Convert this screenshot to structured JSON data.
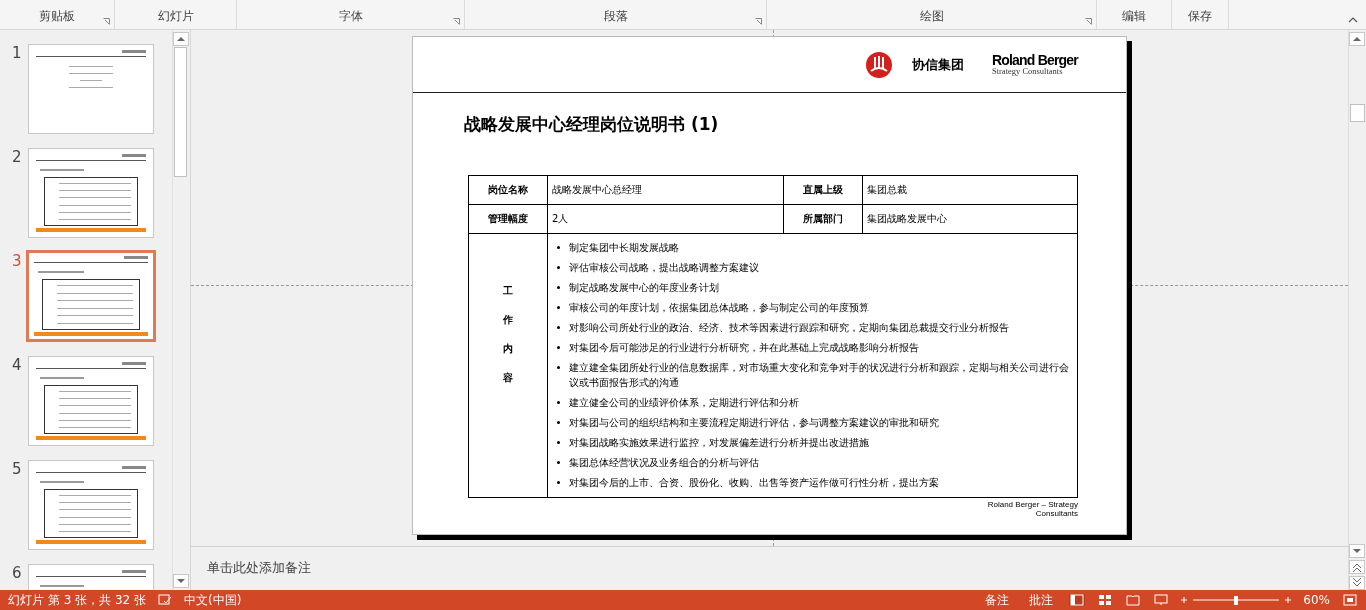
{
  "ribbon": {
    "groups": [
      {
        "label": "剪贴板",
        "launcher": true
      },
      {
        "label": "幻灯片",
        "launcher": false
      },
      {
        "label": "字体",
        "launcher": true
      },
      {
        "label": "段落",
        "launcher": true
      },
      {
        "label": "绘图",
        "launcher": true
      },
      {
        "label": "编辑",
        "launcher": false
      },
      {
        "label": "保存",
        "launcher": false
      }
    ]
  },
  "slides_panel": {
    "thumbnails": [
      {
        "number": "1",
        "selected": false,
        "kind": "cover"
      },
      {
        "number": "2",
        "selected": false,
        "kind": "table"
      },
      {
        "number": "3",
        "selected": true,
        "kind": "table"
      },
      {
        "number": "4",
        "selected": false,
        "kind": "table"
      },
      {
        "number": "5",
        "selected": false,
        "kind": "table"
      },
      {
        "number": "6",
        "selected": false,
        "kind": "table"
      }
    ]
  },
  "slide": {
    "header": {
      "company": "协信集团",
      "partner_name": "Roland Berger",
      "partner_tagline": "Strategy Consultants"
    },
    "title": "战略发展中心经理岗位说明书 (1)",
    "table": {
      "rows": [
        {
          "label_1": "岗位名称",
          "value_1": "战略发展中心总经理",
          "label_2": "直属上级",
          "value_2": "集团总裁"
        },
        {
          "label_1": "管理幅度",
          "value_1": "2人",
          "label_2": "所属部门",
          "value_2": "集团战略发展中心"
        }
      ],
      "duties_label": "工作内容",
      "duties": [
        "制定集团中长期发展战略",
        "评估审核公司战略，提出战略调整方案建议",
        "制定战略发展中心的年度业务计划",
        "审核公司的年度计划，依据集团总体战略，参与制定公司的年度预算",
        "对影响公司所处行业的政治、经济、技术等因素进行跟踪和研究，定期向集团总裁提交行业分析报告",
        "对集团今后可能涉足的行业进行分析研究，并在此基础上完成战略影响分析报告",
        "建立建全集团所处行业的信息数据库，对市场重大变化和竞争对手的状况进行分析和跟踪，定期与相关公司进行会议或书面报告形式的沟通",
        "建立健全公司的业绩评价体系，定期进行评估和分析",
        "对集团与公司的组织结构和主要流程定期进行评估，参与调整方案建议的审批和研究",
        "对集团战略实施效果进行监控，对发展偏差进行分析并提出改进措施",
        "集团总体经营状况及业务组合的分析与评估",
        "对集团今后的上市、合资、股份化、收购、出售等资产运作做可行性分析，提出方案"
      ]
    },
    "footer": "Roland Berger – Strategy Consultants"
  },
  "notes": {
    "placeholder": "单击此处添加备注"
  },
  "status_bar": {
    "slide_info": "幻灯片 第 3 张，共 32 张",
    "language": "中文(中国)",
    "notes_button": "备注",
    "comments_button": "批注",
    "zoom": "60%",
    "zoom_slider": {
      "level": 0.5
    }
  }
}
